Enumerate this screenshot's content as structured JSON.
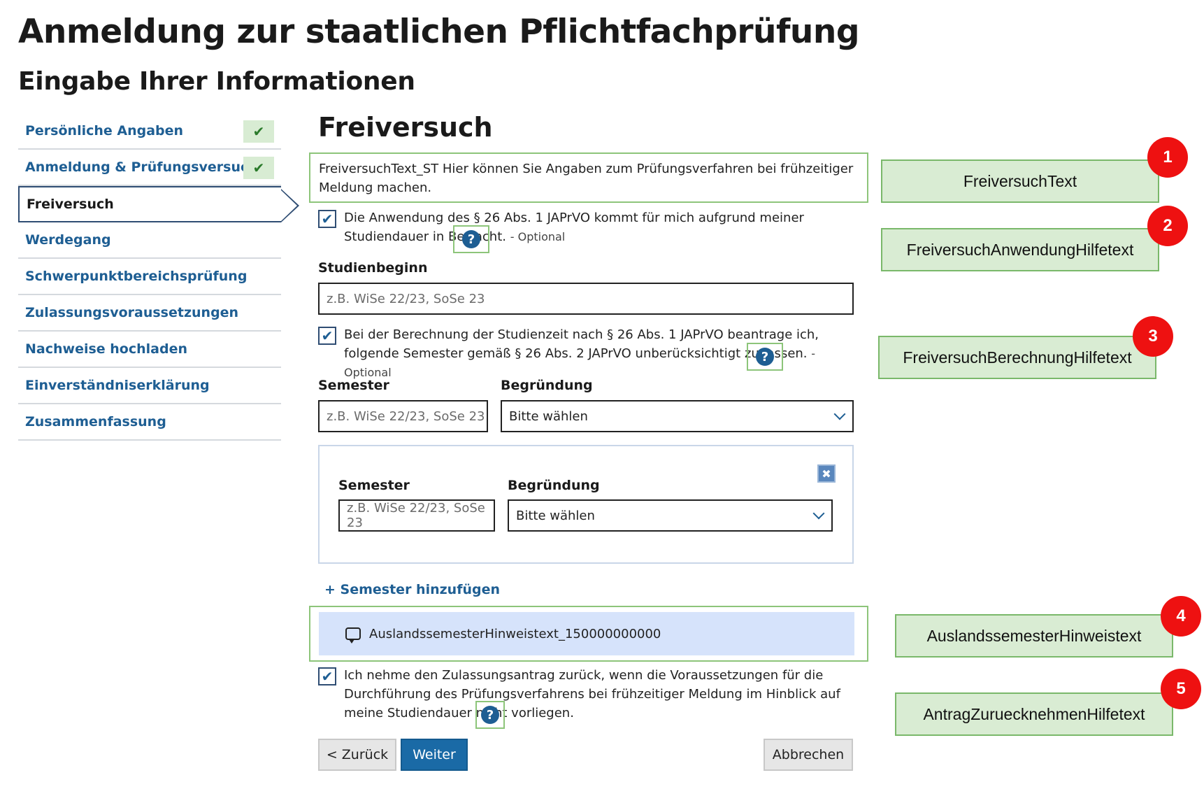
{
  "page": {
    "title": "Anmeldung zur staatlichen Pflichtfachprüfung",
    "subtitle": "Eingabe Ihrer Informationen"
  },
  "sidebar": {
    "items": [
      {
        "label": "Persönliche Angaben",
        "done_mark": "✔"
      },
      {
        "label": "Anmeldung & Prüfungsversuche",
        "done_mark": "✔"
      },
      {
        "label": "Freiversuch"
      },
      {
        "label": "Werdegang"
      },
      {
        "label": "Schwerpunktbereichsprüfung"
      },
      {
        "label": "Zulassungsvoraussetzungen"
      },
      {
        "label": "Nachweise hochladen"
      },
      {
        "label": "Einverständniserklärung"
      },
      {
        "label": "Zusammenfassung"
      }
    ]
  },
  "section": {
    "title": "Freiversuch",
    "intro": "FreiversuchText_ST Hier können Sie Angaben zum Prüfungsverfahren bei frühzeitiger Meldung machen."
  },
  "checkbox1": {
    "mark": "✔",
    "text": "Die Anwendung des § 26 Abs. 1 JAPrVO kommt für mich aufgrund meiner Studiendauer in Betracht.",
    "optional": "- Optional",
    "help": "?"
  },
  "studienbeginn": {
    "label": "Studienbeginn",
    "placeholder": "z.B. WiSe 22/23, SoSe 23"
  },
  "checkbox2": {
    "mark": "✔",
    "text": "Bei der Berechnung der Studienzeit nach § 26 Abs. 1 JAPrVO beantrage ich, folgende Semester gemäß § 26 Abs. 2 JAPrVO unberücksichtigt zu lassen.",
    "optional": "- Optional",
    "help": "?"
  },
  "semester_rows": [
    {
      "semester_label": "Semester",
      "semester_placeholder": "z.B. WiSe 22/23, SoSe 23",
      "reason_label": "Begründung",
      "reason_value": "Bitte wählen"
    },
    {
      "semester_label": "Semester",
      "semester_placeholder": "z.B. WiSe 22/23, SoSe 23",
      "reason_label": "Begründung",
      "reason_value": "Bitte wählen",
      "remove": "✖"
    }
  ],
  "add_semester": "+ Semester hinzufügen",
  "hint": {
    "text": "AuslandssemesterHinweistext_150000000000"
  },
  "checkbox3": {
    "mark": "✔",
    "text": "Ich nehme den Zulassungsantrag zurück, wenn die Voraussetzungen für die Durchführung des Prüfungsverfahrens bei frühzeitiger Meldung im Hinblick auf meine Studiendauer nicht vorliegen.",
    "help": "?"
  },
  "buttons": {
    "back": "< Zurück",
    "next": "Weiter",
    "cancel": "Abbrechen"
  },
  "annotations": [
    {
      "number": "1",
      "label": "FreiversuchText"
    },
    {
      "number": "2",
      "label": "FreiversuchAnwendungHilfetext"
    },
    {
      "number": "3",
      "label": "FreiversuchBerechnungHilfetext"
    },
    {
      "number": "4",
      "label": "AuslandssemesterHinweistext"
    },
    {
      "number": "5",
      "label": "AntragZuruecknehmenHilfetext"
    }
  ],
  "colors": {
    "link_blue": "#1e5e93",
    "primary_button": "#1a6aa6",
    "highlight_green": "#8dc57a",
    "annotation_fill": "#d9ecd3",
    "badge_red": "#ee1111",
    "hint_bg": "#d6e3fb"
  }
}
